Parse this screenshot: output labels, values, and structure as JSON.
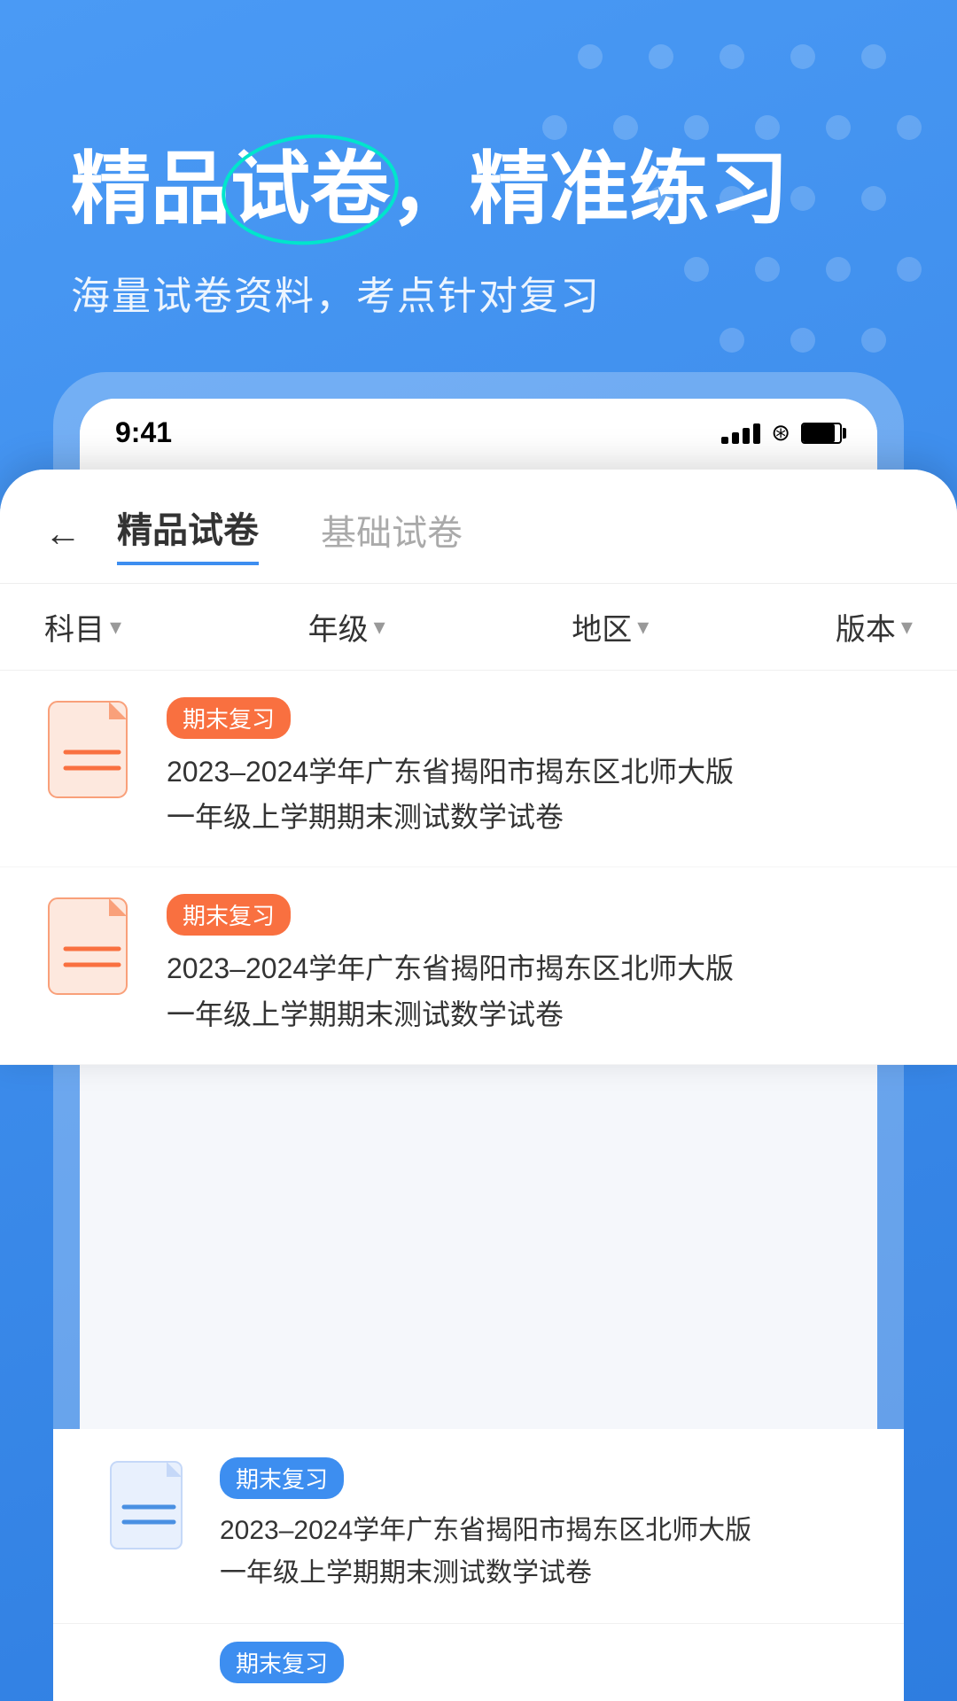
{
  "hero": {
    "title_before": "精品",
    "title_highlight": "试卷",
    "title_comma": "，",
    "title_after": "精准练习",
    "subtitle": "海量试卷资料，考点针对复习"
  },
  "status_bar": {
    "time": "9:41"
  },
  "background_nav": {
    "back_icon": "←",
    "tab1": "精品试卷",
    "tab2": "基础试卷",
    "tab2_active": true
  },
  "background_filters": {
    "subject": "科目",
    "grade": "年级",
    "region": "地区",
    "version": "版本"
  },
  "background_items": [
    {
      "tag": "期末复习",
      "title": "2023–2024学年广东省揭阳市揭东区北师大版\n一年级上学期期末测试数学试卷"
    },
    {
      "tag": "期末复习",
      "title": "2023–2024学年广东省揭阳市揭东区北师大版"
    }
  ],
  "main_card": {
    "tab1": "精品试卷",
    "tab1_active": true,
    "tab2": "基础试卷",
    "filters": {
      "subject": "科目",
      "grade": "年级",
      "region": "地区",
      "version": "版本"
    },
    "items": [
      {
        "tag": "期末复习",
        "title": "2023–2024学年广东省揭阳市揭东区北师大版\n一年级上学期期末测试数学试卷",
        "color": "orange"
      },
      {
        "tag": "期末复习",
        "title": "2023–2024学年广东省揭阳市揭东区北师大版\n一年级上学期期末测试数学试卷",
        "color": "orange"
      }
    ]
  },
  "bottom_items": [
    {
      "tag": "期末复习",
      "title": "2023–2024学年广东省揭阳市揭东区北师大版\n一年级上学期期末测试数学试卷",
      "color": "blue"
    }
  ],
  "icons": {
    "back": "←",
    "dropdown": "▾",
    "doc_blue": "document-blue",
    "doc_orange": "document-orange"
  }
}
